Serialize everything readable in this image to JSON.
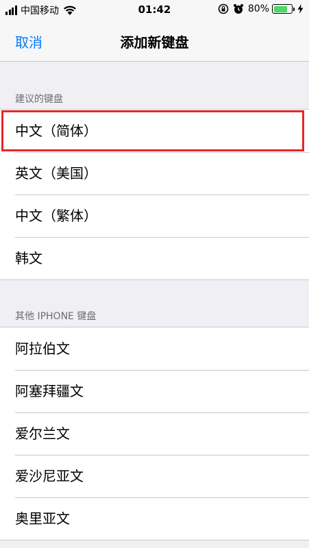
{
  "status_bar": {
    "carrier": "中国移动",
    "time": "01:42",
    "battery_percent": "80%",
    "battery_level": 0.8,
    "battery_color": "#4cd964",
    "icons": [
      "signal-icon",
      "wifi-icon",
      "orientation-lock-icon",
      "alarm-icon",
      "battery-icon",
      "charging-icon"
    ]
  },
  "nav": {
    "cancel_label": "取消",
    "title": "添加新键盘"
  },
  "suggested": {
    "header": "建议的键盘",
    "items": [
      "中文（简体）",
      "英文（美国）",
      "中文（繁体）",
      "韩文"
    ]
  },
  "other": {
    "header": "其他 IPHONE 键盘",
    "items": [
      "阿拉伯文",
      "阿塞拜疆文",
      "爱尔兰文",
      "爱沙尼亚文",
      "奥里亚文"
    ]
  },
  "accent_color": "#007aff",
  "highlight_color": "#e5262a"
}
